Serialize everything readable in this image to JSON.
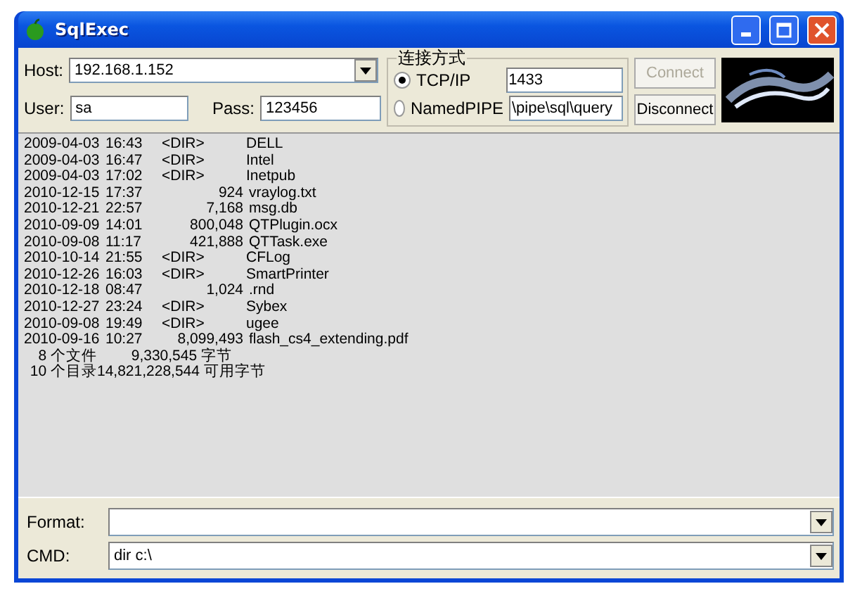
{
  "window": {
    "title": "SqlExec"
  },
  "login": {
    "host_label": "Host:",
    "host": "192.168.1.152",
    "user_label": "User:",
    "user": "sa",
    "pass_label": "Pass:",
    "pass": "123456"
  },
  "connection": {
    "legend": "连接方式",
    "options": [
      {
        "label": "TCP/IP",
        "selected": true,
        "value": "1433"
      },
      {
        "label": "NamedPIPE",
        "selected": false,
        "value": "\\pipe\\sql\\query"
      }
    ]
  },
  "buttons": [
    {
      "label": "Connect",
      "disabled": true
    },
    {
      "label": "Disconnect",
      "disabled": false
    }
  ],
  "output": {
    "rows": [
      {
        "kind": "dir",
        "date": "2009-04-03",
        "time": "16:43",
        "size": "<DIR>",
        "name": "DELL"
      },
      {
        "kind": "dir",
        "date": "2009-04-03",
        "time": "16:47",
        "size": "<DIR>",
        "name": "Intel"
      },
      {
        "kind": "dir",
        "date": "2009-04-03",
        "time": "17:02",
        "size": "<DIR>",
        "name": "Inetpub"
      },
      {
        "kind": "file",
        "date": "2010-12-15",
        "time": "17:37",
        "size": "924",
        "name": "vraylog.txt"
      },
      {
        "kind": "file",
        "date": "2010-12-21",
        "time": "22:57",
        "size": "7,168",
        "name": "msg.db"
      },
      {
        "kind": "file",
        "date": "2010-09-09",
        "time": "14:01",
        "size": "800,048",
        "name": "QTPlugin.ocx"
      },
      {
        "kind": "file",
        "date": "2010-09-08",
        "time": "11:17",
        "size": "421,888",
        "name": "QTTask.exe"
      },
      {
        "kind": "dir",
        "date": "2010-10-14",
        "time": "21:55",
        "size": "<DIR>",
        "name": "CFLog"
      },
      {
        "kind": "dir",
        "date": "2010-12-26",
        "time": "16:03",
        "size": "<DIR>",
        "name": "SmartPrinter"
      },
      {
        "kind": "file",
        "date": "2010-12-18",
        "time": "08:47",
        "size": "1,024",
        "name": ".rnd"
      },
      {
        "kind": "dir",
        "date": "2010-12-27",
        "time": "23:24",
        "size": "<DIR>",
        "name": "Sybex"
      },
      {
        "kind": "dir",
        "date": "2010-09-08",
        "time": "19:49",
        "size": "<DIR>",
        "name": "ugee"
      },
      {
        "kind": "file",
        "date": "2010-09-16",
        "time": "10:27",
        "size": "8,099,493",
        "name": "flash_cs4_extending.pdf"
      }
    ],
    "summary": [
      {
        "count": "8 个文件",
        "bytes": "9,330,545 字节"
      },
      {
        "count": "10 个目录",
        "bytes": "14,821,228,544 可用字节"
      }
    ]
  },
  "format": {
    "label": "Format:"
  },
  "cmd": {
    "label": "CMD:",
    "value": "dir c:\\"
  }
}
